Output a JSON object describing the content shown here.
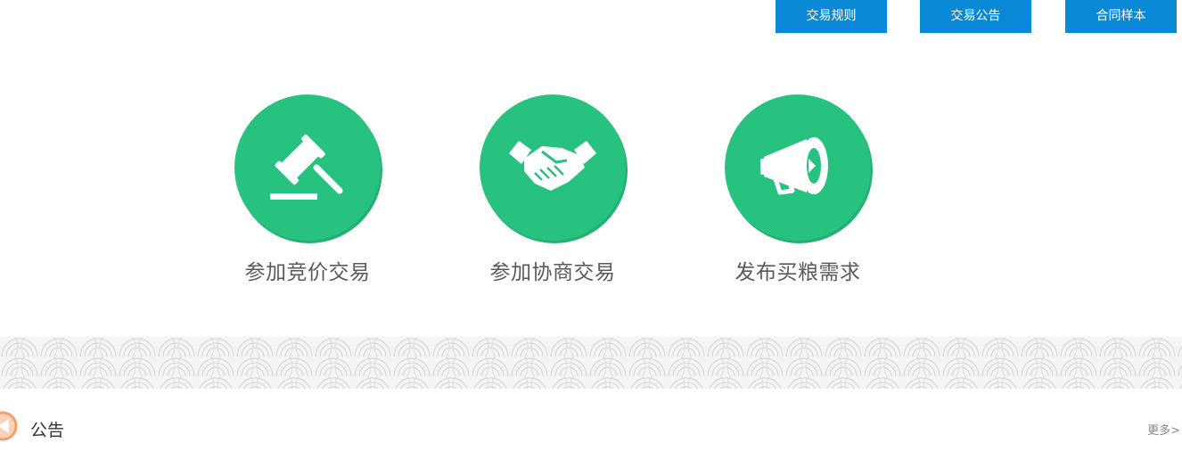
{
  "top_nav": {
    "rules_label": "交易规则",
    "notice_label": "交易公告",
    "contract_label": "合同样本"
  },
  "actions": [
    {
      "label": "参加竞价交易",
      "icon": "gavel-icon"
    },
    {
      "label": "参加协商交易",
      "icon": "handshake-icon"
    },
    {
      "label": "发布买粮需求",
      "icon": "megaphone-icon"
    }
  ],
  "notice_section": {
    "title": "公告",
    "more_label": "更多>",
    "icon": "speaker-icon"
  },
  "colors": {
    "nav_button": "#0a8ad6",
    "action_circle": "#27c27f",
    "label_text": "#5a5a5a",
    "notice_icon": "#f0a070"
  }
}
